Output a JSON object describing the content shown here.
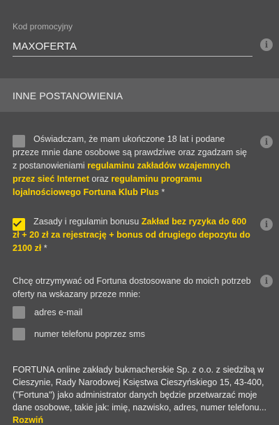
{
  "promo": {
    "label": "Kod promocyjny",
    "value": "MAXOFERTA"
  },
  "section": {
    "title": "INNE POSTANOWIENIA"
  },
  "consent_age": {
    "checked": false,
    "text_start": "Oświadczam, że mam ukończone 18 lat i podane przeze mnie dane osobowe są prawdziwe oraz zgadzam się z postanowieniami ",
    "link1": "regulaminu zakładów wzajemnych przez sieć Internet",
    "text_mid": " oraz ",
    "link2": "regulaminu programu lojalnościowego Fortuna Klub Plus",
    "text_end": " *"
  },
  "consent_bonus": {
    "checked": true,
    "text_start": "Zasady i regulamin bonusu ",
    "link": "Zakład bez ryzyka do 600 zł + 20 zł za rejestrację + bonus od drugiego depozytu do 2100 zł",
    "text_end": " *"
  },
  "offers": {
    "text": "Chcę otrzymywać od Fortuna dostosowane do moich potrzeb oferty na wskazany przeze mnie:",
    "options": [
      {
        "label": "adres e-mail",
        "checked": false
      },
      {
        "label": "numer telefonu poprzez sms",
        "checked": false
      }
    ]
  },
  "footer": {
    "text": "FORTUNA online zakłady bukmacherskie Sp. z o.o. z siedzibą w Cieszynie, Rady Narodowej Księstwa Cieszyńskiego 15, 43-400, (\"Fortuna\") jako administrator danych będzie przetwarzać moje dane osobowe, takie jak: imię, nazwisko, adres, numer telefonu...",
    "expand_link": "Rozwiń"
  },
  "colors": {
    "background": "#4a4a4b",
    "header": "#5e5e5f",
    "accent": "#ffd200"
  },
  "icons": {
    "info": "info-icon",
    "check": "check-icon"
  }
}
